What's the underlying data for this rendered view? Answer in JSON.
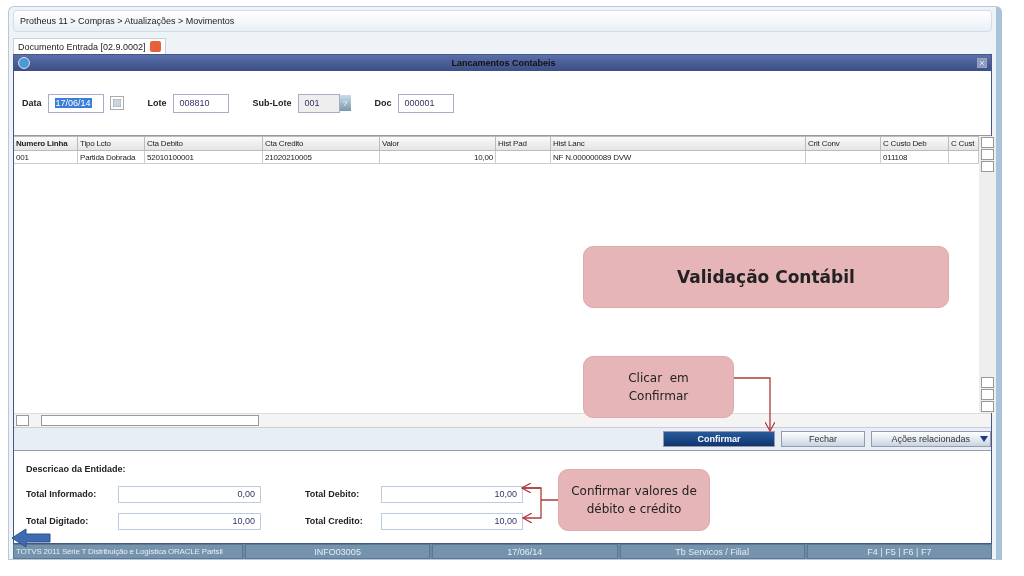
{
  "breadcrumb": "Protheus 11 > Compras  > Atualizações > Movimentos",
  "tab": {
    "label": "Documento Entrada [02.9.0002]",
    "closable": true
  },
  "dialog": {
    "title": "Lancamentos Contabeis",
    "fields": [
      {
        "label": "Data",
        "value": "17/06/14",
        "kind": "date",
        "highlighted": true
      },
      {
        "label": "Lote",
        "value": "008810",
        "kind": "text",
        "highlighted": false
      },
      {
        "label": "Sub-Lote",
        "value": "001",
        "kind": "lookup",
        "highlighted": false,
        "button": "?"
      },
      {
        "label": "Doc",
        "value": "000001",
        "kind": "text",
        "highlighted": false
      }
    ],
    "table": {
      "columns": [
        "Numero Linha",
        "Tipo Lcto",
        "Cta Debito",
        "Cta Credito",
        "Valor",
        "Hist Pad",
        "Hist Lanc",
        "Crit Conv",
        "C Custo Deb",
        "C Cust"
      ],
      "rows": [
        [
          "001",
          "Partida Dobrada",
          "52010100001",
          "21020210005",
          "10,00",
          "",
          "NF N.000000089 DVW",
          "",
          "011108",
          ""
        ]
      ]
    },
    "buttons": [
      {
        "label": "Confirmar",
        "kind": "primary"
      },
      {
        "label": "Fechar",
        "kind": "normal"
      },
      {
        "label": "Ações relacionadas",
        "kind": "menu"
      }
    ],
    "entity_label": "Descricao da Entidade:",
    "totals": [
      {
        "label": "Total Informado:",
        "value": "0,00"
      },
      {
        "label": "Total Debito:",
        "value": "10,00"
      },
      {
        "label": "Total Digitado:",
        "value": "10,00"
      },
      {
        "label": "Total Credito:",
        "value": "10,00"
      }
    ]
  },
  "status_bar": [
    "TOTVS 2011 Série T Distribuição e Logística ORACLE Partsil",
    "INFO03005",
    "17/06/14",
    "Tb Servicos / Filial",
    "F4 | F5 | F6 | F7"
  ],
  "callouts": [
    "Validação Contábil",
    "Clicar  em\nConfirmar",
    "Confirmar valores de débito e crédito"
  ]
}
